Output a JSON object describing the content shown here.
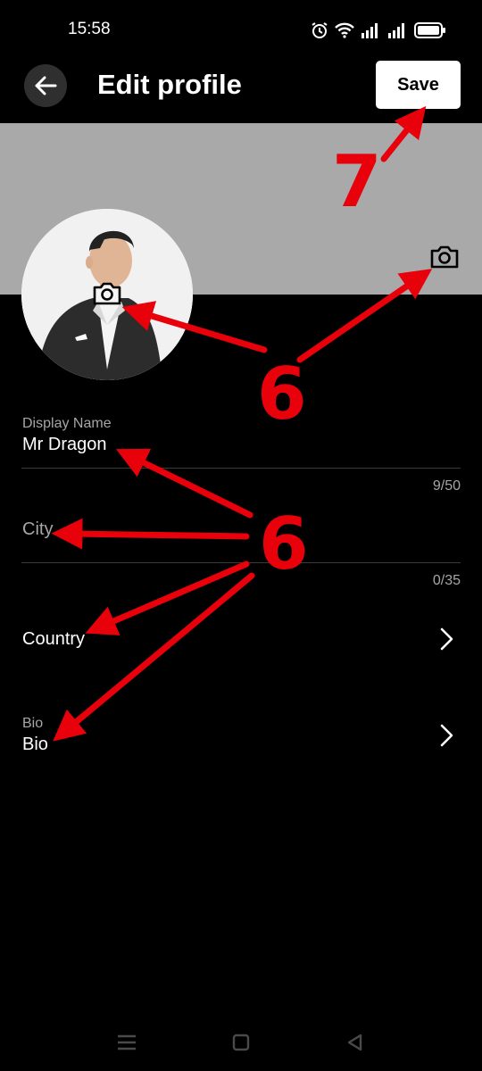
{
  "status": {
    "time": "15:58"
  },
  "header": {
    "title": "Edit profile",
    "save_label": "Save"
  },
  "form": {
    "display_name": {
      "label": "Display Name",
      "value": "Mr Dragon",
      "counter": "9/50"
    },
    "city": {
      "placeholder": "City",
      "counter": "0/35"
    },
    "country": {
      "label": "Country"
    },
    "bio": {
      "label": "Bio",
      "value": "Bio"
    }
  },
  "annotations": {
    "step6_label": "6",
    "step7_label": "7",
    "annotation_color": "#e8000b"
  },
  "icons": [
    "back-arrow-icon",
    "camera-icon",
    "chevron-right-icon",
    "alarm-icon",
    "wifi-icon",
    "signal-icon",
    "battery-icon",
    "menu-icon",
    "home-icon",
    "back-icon"
  ]
}
